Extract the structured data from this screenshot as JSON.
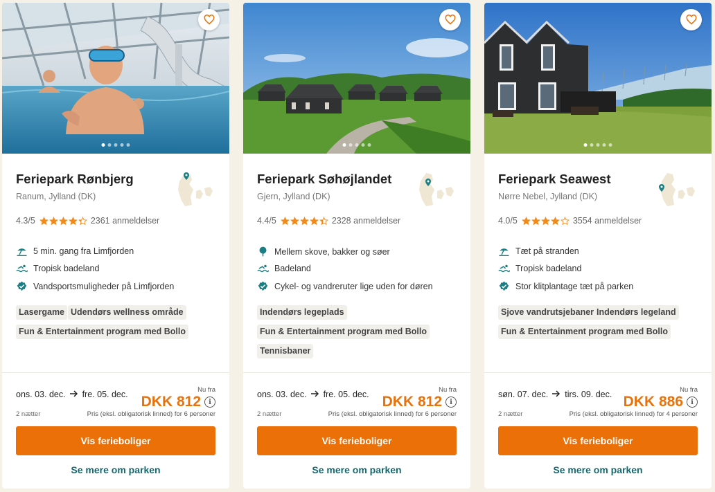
{
  "colors": {
    "accent": "#ec7008",
    "price": "#e8730c",
    "link": "#15696f",
    "teal_icon": "#1a7f85",
    "star": "#f08a1c"
  },
  "cards": [
    {
      "title": "Feriepark Rønbjerg",
      "location": "Ranum, Jylland (DK)",
      "rating": "4.3/5",
      "stars": 4.3,
      "reviews": "2361 anmeldelser",
      "features": [
        {
          "icon": "beach-umbrella-icon",
          "text": "5 min. gang fra Limfjorden"
        },
        {
          "icon": "swimmer-icon",
          "text": "Tropisk badeland"
        },
        {
          "icon": "verified-check-icon",
          "text": "Vandsportsmuligheder på Limfjorden"
        }
      ],
      "tags": [
        "Lasergame",
        "Udendørs wellness område",
        "Fun & Entertainment program med Bollo"
      ],
      "date_from": "ons. 03. dec.",
      "date_to": "fre. 05. dec.",
      "nights": "2 nætter",
      "price_prefix": "Nu fra",
      "price": "DKK 812",
      "price_note": "Pris (eksl. obligatorisk linned) for 6 personer",
      "button": "Vis ferieboliger",
      "link": "Se mere om parken"
    },
    {
      "title": "Feriepark Søhøjlandet",
      "location": "Gjern, Jylland (DK)",
      "rating": "4.4/5",
      "stars": 4.4,
      "reviews": "2328 anmeldelser",
      "features": [
        {
          "icon": "tree-icon",
          "text": "Mellem skove, bakker og søer"
        },
        {
          "icon": "swimmer-icon",
          "text": "Badeland"
        },
        {
          "icon": "verified-check-icon",
          "text": "Cykel- og vandreruter lige uden for døren"
        }
      ],
      "tags": [
        "Indendørs legeplads",
        "Fun & Entertainment program med Bollo",
        "Tennisbaner"
      ],
      "date_from": "ons. 03. dec.",
      "date_to": "fre. 05. dec.",
      "nights": "2 nætter",
      "price_prefix": "Nu fra",
      "price": "DKK 812",
      "price_note": "Pris (eksl. obligatorisk linned) for 6 personer",
      "button": "Vis ferieboliger",
      "link": "Se mere om parken"
    },
    {
      "title": "Feriepark Seawest",
      "location": "Nørre Nebel, Jylland (DK)",
      "rating": "4.0/5",
      "stars": 4.0,
      "reviews": "3554 anmeldelser",
      "features": [
        {
          "icon": "beach-umbrella-icon",
          "text": "Tæt på stranden"
        },
        {
          "icon": "swimmer-icon",
          "text": "Tropisk badeland"
        },
        {
          "icon": "verified-check-icon",
          "text": "Stor klitplantage tæt på parken"
        }
      ],
      "tags": [
        "Sjove vandrutsjebaner",
        "Indendørs legeland",
        "Fun & Entertainment program med Bollo"
      ],
      "date_from": "søn. 07. dec.",
      "date_to": "tirs. 09. dec.",
      "nights": "2 nætter",
      "price_prefix": "Nu fra",
      "price": "DKK 886",
      "price_note": "Pris (eksl. obligatorisk linned) for 4 personer",
      "button": "Vis ferieboliger",
      "link": "Se mere om parken"
    }
  ]
}
